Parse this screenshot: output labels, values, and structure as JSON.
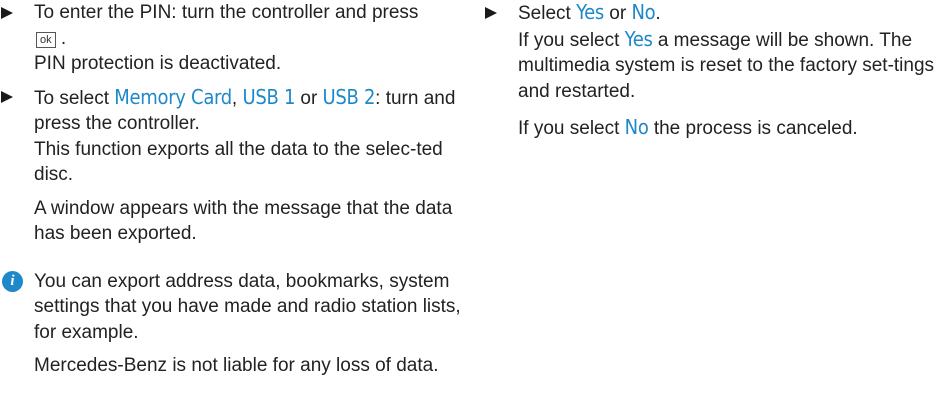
{
  "left": {
    "step1": {
      "text_a": "To enter the PIN: turn the controller and press",
      "key_label": "ok",
      "text_b": " .",
      "result": "PIN protection is deactivated."
    },
    "step2": {
      "text_a": "To select ",
      "option1": "Memory Card",
      "sep1": ", ",
      "option2": "USB 1",
      "sep2": " or ",
      "option3": "USB 2",
      "text_b": ": turn and press the controller.",
      "detail1": "This function exports all the data to the selec-ted disc.",
      "detail2": "A window appears with the message that the data has been exported."
    },
    "info": {
      "icon_glyph": "i",
      "text1": "You can export address data, bookmarks, system settings that you have made and radio station lists, for example.",
      "text2": "Mercedes-Benz is not liable for any loss of data."
    }
  },
  "right": {
    "step": {
      "text_a": "Select ",
      "yes": "Yes",
      "or": " or ",
      "no": "No",
      "period": ".",
      "line2_a": "If you select ",
      "line2_yes": "Yes",
      "line2_b": " a message will be shown. The multimedia system is reset to the factory set-tings and restarted.",
      "line3_a": "If you select ",
      "line3_no": "No",
      "line3_b": " the process is canceled."
    }
  },
  "colors": {
    "keyword": "#1e88c9",
    "text": "#222222",
    "icon_bg": "#1e88c9"
  }
}
